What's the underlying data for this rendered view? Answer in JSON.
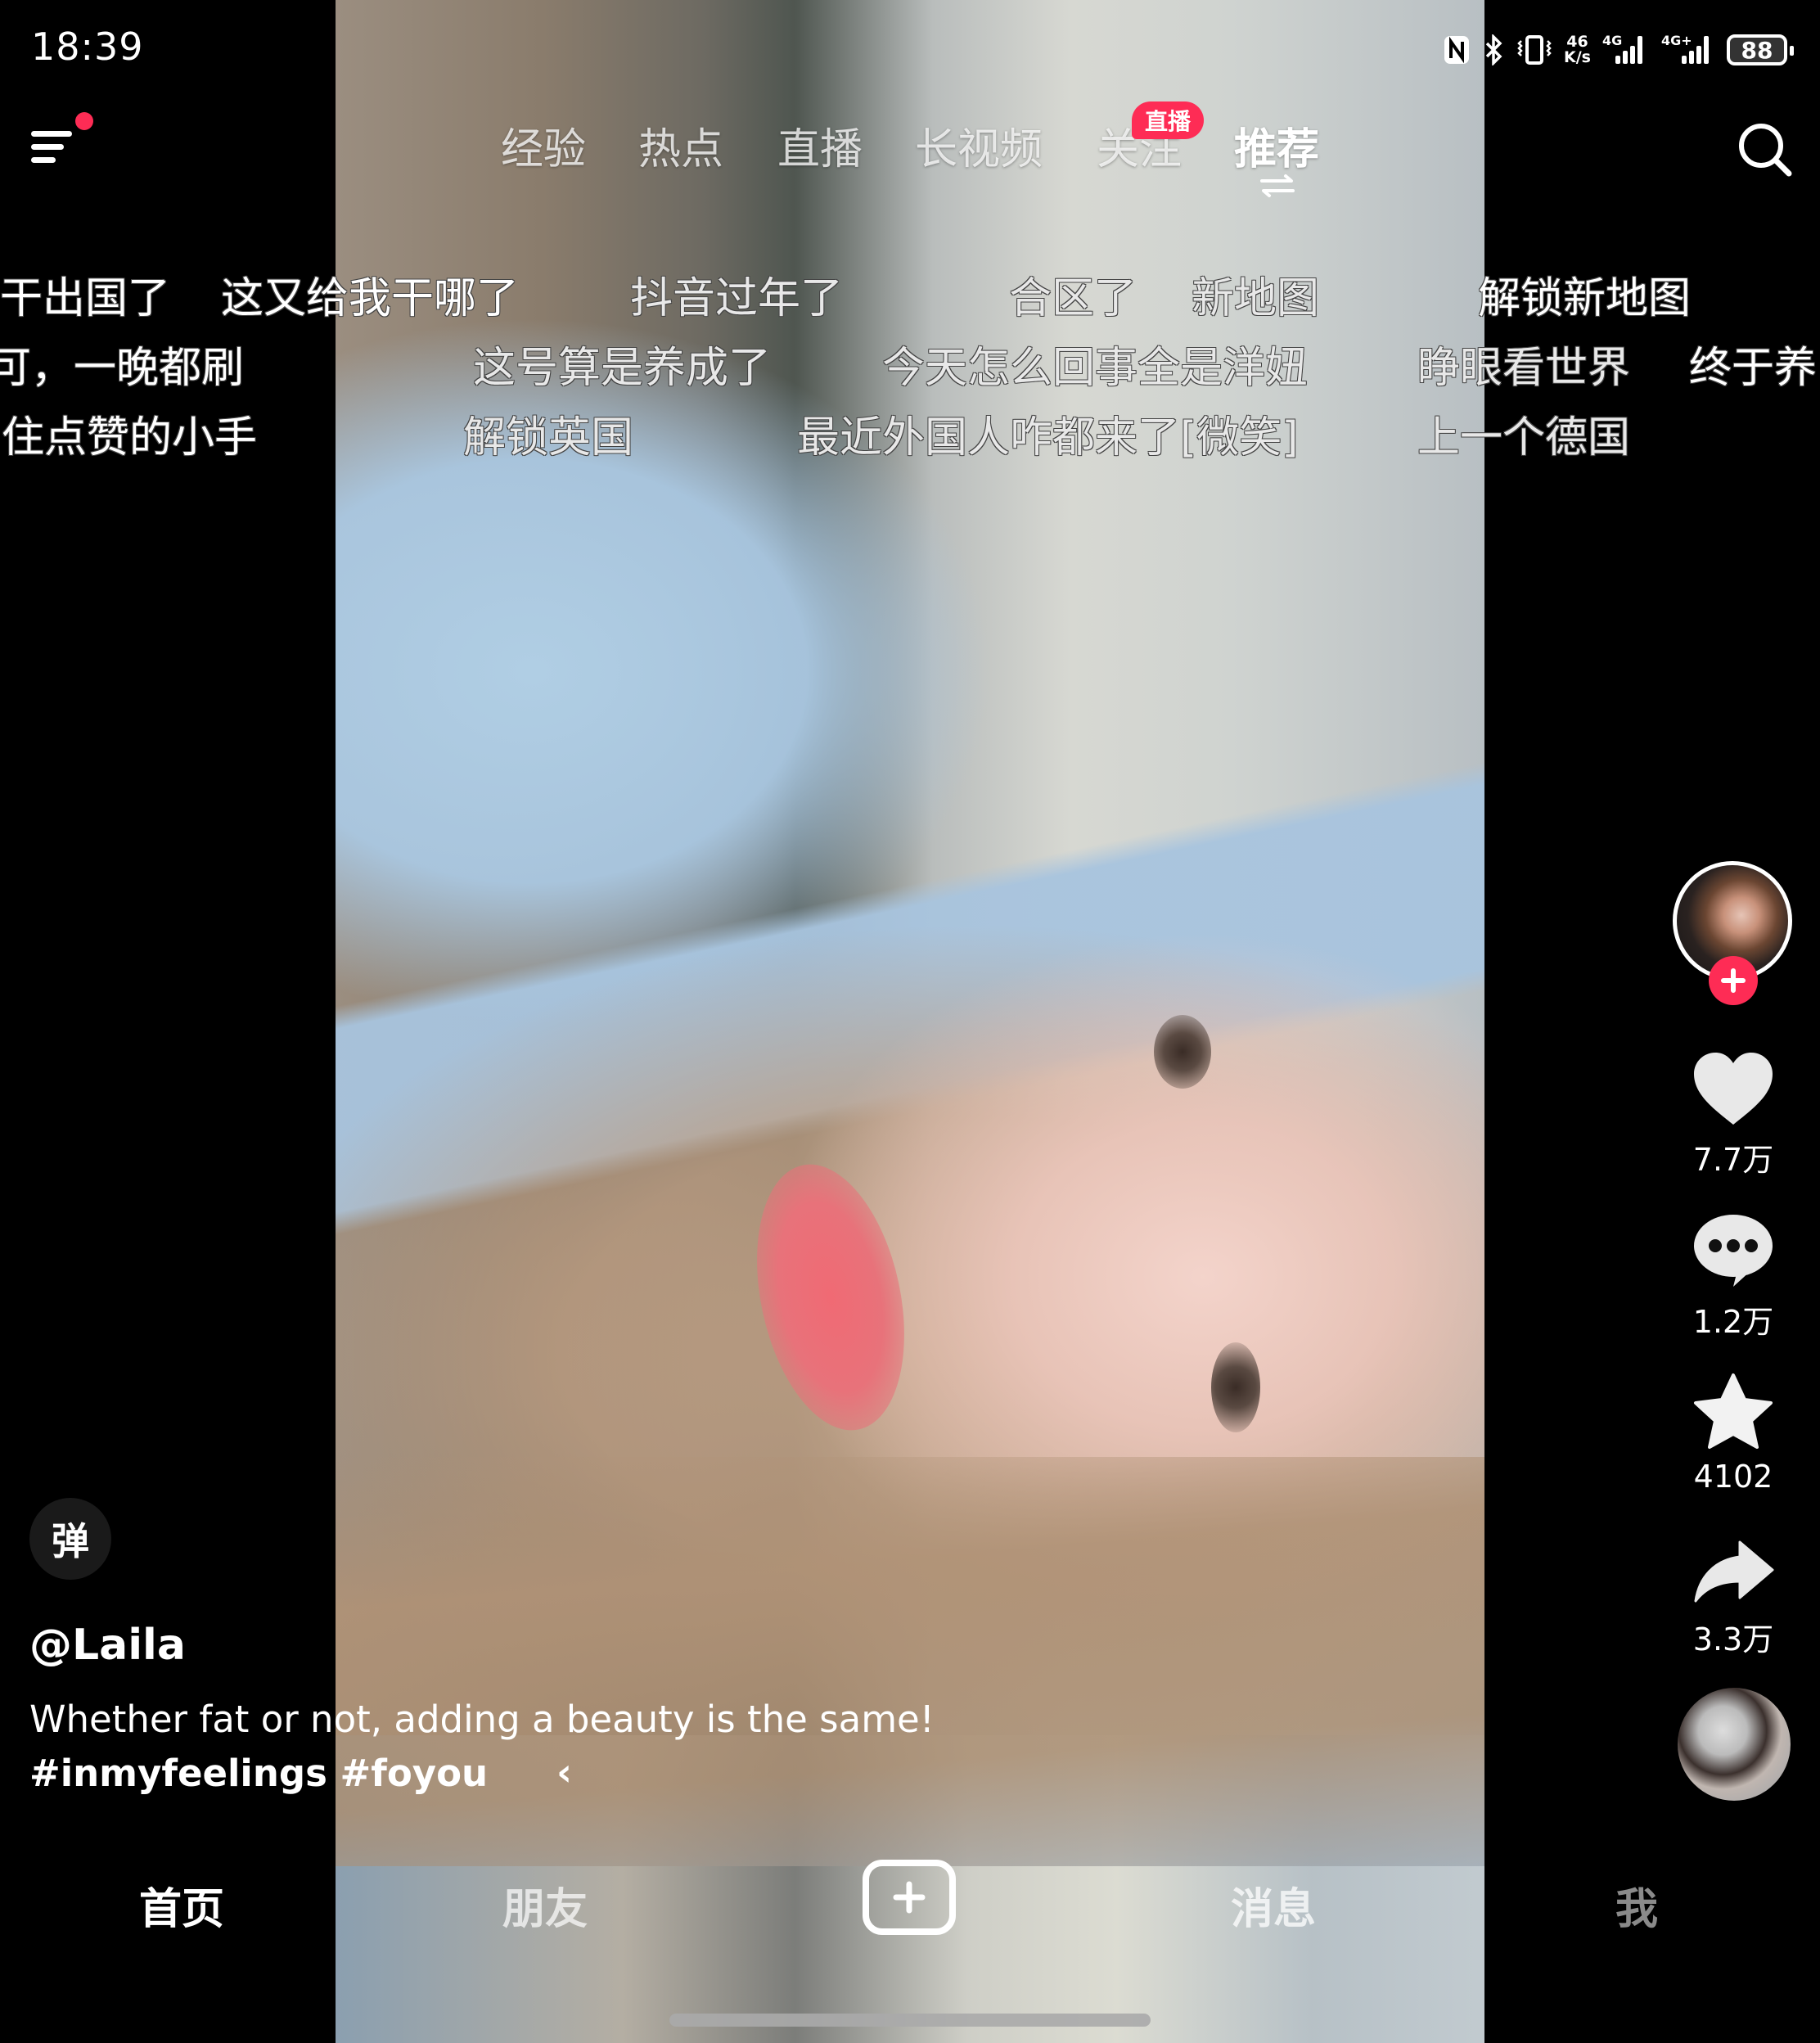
{
  "status_bar": {
    "time": "18:39",
    "icons": [
      "nfc-icon",
      "bluetooth-icon",
      "vibrate-icon",
      "network-speed",
      "signal-4g",
      "signal-4g-plus",
      "battery"
    ],
    "net_speed_value": "46",
    "net_speed_unit": "K/s",
    "signal1_label": "4G",
    "signal2_label": "4G+",
    "battery_level": "88"
  },
  "header": {
    "menu_icon": "hamburger-menu-icon",
    "menu_has_notification": true,
    "tabs": [
      {
        "label": "经验"
      },
      {
        "label": "热点"
      },
      {
        "label": "直播"
      },
      {
        "label": "长视频"
      },
      {
        "label": "关注",
        "badge": "直播"
      },
      {
        "label": "推荐",
        "active": true
      }
    ],
    "search_icon": "search-icon"
  },
  "danmaku": [
    {
      "text": "干出国了"
    },
    {
      "text": "这又给我干哪了"
    },
    {
      "text": "抖音过年了"
    },
    {
      "text": "合区了"
    },
    {
      "text": "新地图"
    },
    {
      "text": "解锁新地图"
    },
    {
      "text": "可，一晚都刷"
    },
    {
      "text": "这号算是养成了"
    },
    {
      "text": "今天怎么回事全是洋妞"
    },
    {
      "text": "睁眼看世界"
    },
    {
      "text": "终于养"
    },
    {
      "text": "住点赞的小手"
    },
    {
      "text": "解锁英国"
    },
    {
      "text": "最近外国人咋都来了[微笑]"
    },
    {
      "text": "上一个德国"
    }
  ],
  "actions": {
    "likes": "7.7万",
    "comments": "1.2万",
    "favorites": "4102",
    "shares": "3.3万"
  },
  "video": {
    "author": "@Laila",
    "caption": "Whether fat or not, adding a beauty is the same!",
    "hashtags": "#inmyfeelings #foyou",
    "expand_glyph": "‹",
    "danmaku_toggle_label": "弹"
  },
  "bottom_nav": {
    "items": [
      {
        "label": "首页",
        "active": true
      },
      {
        "label": "朋友"
      },
      {
        "label": "+"
      },
      {
        "label": "消息"
      },
      {
        "label": "我"
      }
    ]
  },
  "colors": {
    "accent": "#fe2c55",
    "background": "#000000",
    "text": "#ffffff"
  }
}
